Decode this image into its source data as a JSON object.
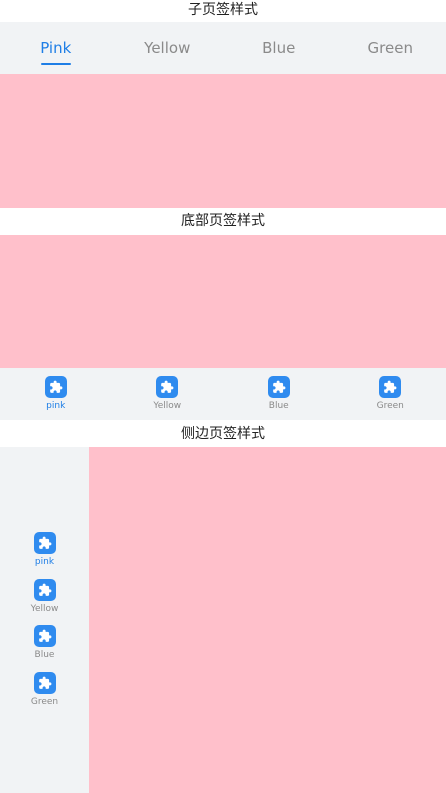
{
  "colors": {
    "accent": "#1e7ee6",
    "inactive_text": "#8a8a8a",
    "tabbar_bg": "#f1f3f5",
    "content_bg": "#ffc0cb",
    "icon_bg": "#2f8bef"
  },
  "section1": {
    "title": "子页签样式",
    "tabs": [
      {
        "label": "Pink",
        "active": true
      },
      {
        "label": "Yellow",
        "active": false
      },
      {
        "label": "Blue",
        "active": false
      },
      {
        "label": "Green",
        "active": false
      }
    ]
  },
  "section2": {
    "title": "底部页签样式",
    "tabs": [
      {
        "label": "pink",
        "icon": "puzzle-icon",
        "active": true
      },
      {
        "label": "Yellow",
        "icon": "puzzle-icon",
        "active": false
      },
      {
        "label": "Blue",
        "icon": "puzzle-icon",
        "active": false
      },
      {
        "label": "Green",
        "icon": "puzzle-icon",
        "active": false
      }
    ]
  },
  "section3": {
    "title": "侧边页签样式",
    "tabs": [
      {
        "label": "pink",
        "icon": "puzzle-icon",
        "active": true
      },
      {
        "label": "Yellow",
        "icon": "puzzle-icon",
        "active": false
      },
      {
        "label": "Blue",
        "icon": "puzzle-icon",
        "active": false
      },
      {
        "label": "Green",
        "icon": "puzzle-icon",
        "active": false
      }
    ]
  }
}
